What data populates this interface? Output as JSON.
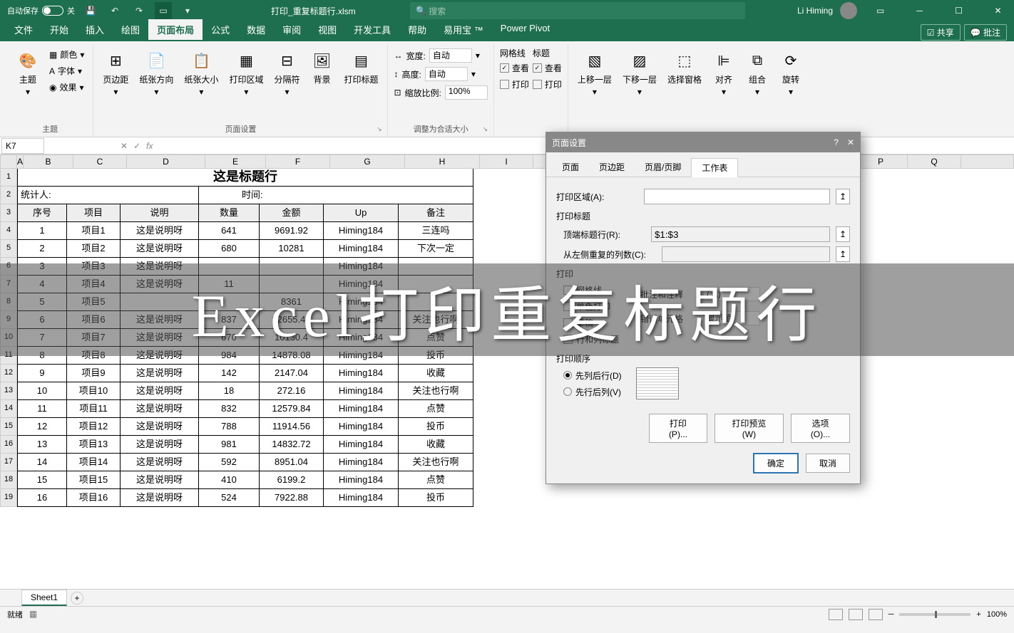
{
  "title": {
    "autosave": "自动保存",
    "autosave_state": "关",
    "filename": "打印_重复标题行.xlsm",
    "search_placeholder": "搜索",
    "username": "Li Himing"
  },
  "tabs": [
    "文件",
    "开始",
    "插入",
    "绘图",
    "页面布局",
    "公式",
    "数据",
    "审阅",
    "视图",
    "开发工具",
    "帮助",
    "易用宝 ™",
    "Power Pivot"
  ],
  "tab_active_index": 4,
  "share": "共享",
  "comment": "批注",
  "ribbon": {
    "themes": {
      "theme": "主题",
      "colors": "颜色",
      "fonts": "字体",
      "effects": "效果",
      "group": "主题"
    },
    "page_setup": {
      "margins": "页边距",
      "orientation": "纸张方向",
      "size": "纸张大小",
      "print_area": "打印区域",
      "breaks": "分隔符",
      "background": "背景",
      "print_titles": "打印标题",
      "group": "页面设置"
    },
    "scale": {
      "width": "宽度:",
      "height": "高度:",
      "scale": "缩放比例:",
      "auto": "自动",
      "pct": "100%",
      "group": "调整为合适大小"
    },
    "sheet_opts": {
      "gridlines": "网格线",
      "headings": "标题",
      "view": "查看",
      "print": "打印"
    },
    "arrange": {
      "bring_fwd": "上移一层",
      "send_back": "下移一层",
      "selection": "选择窗格",
      "align": "对齐",
      "group_btn": "组合",
      "rotate": "旋转"
    }
  },
  "namebox": "K7",
  "sheet": {
    "cols": [
      "A",
      "B",
      "C",
      "D",
      "E",
      "F",
      "G",
      "H"
    ],
    "title": "这是标题行",
    "stat_label": "统计人:",
    "time_label": "时间:",
    "headers": [
      "序号",
      "项目",
      "说明",
      "数量",
      "金额",
      "Up",
      "备注"
    ],
    "rows": [
      [
        "1",
        "项目1",
        "这是说明呀",
        "641",
        "9691.92",
        "Himing184",
        "三连吗"
      ],
      [
        "2",
        "项目2",
        "这是说明呀",
        "680",
        "10281",
        "Himing184",
        "下次一定"
      ],
      [
        "3",
        "项目3",
        "这是说明呀",
        "",
        "",
        "Himing184",
        ""
      ],
      [
        "4",
        "项目4",
        "这是说明呀",
        "11",
        "",
        "Himing184",
        ""
      ],
      [
        "5",
        "项目5",
        "",
        "",
        "8361",
        "Himing184",
        ""
      ],
      [
        "6",
        "项目6",
        "这是说明呀",
        "837",
        "12655.44",
        "Himing184",
        "关注也行啊"
      ],
      [
        "7",
        "项目7",
        "这是说明呀",
        "670",
        "10130.4",
        "Himing184",
        "点赞"
      ],
      [
        "8",
        "项目8",
        "这是说明呀",
        "984",
        "14878.08",
        "Himing184",
        "投币"
      ],
      [
        "9",
        "项目9",
        "这是说明呀",
        "142",
        "2147.04",
        "Himing184",
        "收藏"
      ],
      [
        "10",
        "项目10",
        "这是说明呀",
        "18",
        "272.16",
        "Himing184",
        "关注也行啊"
      ],
      [
        "11",
        "项目11",
        "这是说明呀",
        "832",
        "12579.84",
        "Himing184",
        "点赞"
      ],
      [
        "12",
        "项目12",
        "这是说明呀",
        "788",
        "11914.56",
        "Himing184",
        "投币"
      ],
      [
        "13",
        "项目13",
        "这是说明呀",
        "981",
        "14832.72",
        "Himing184",
        "收藏"
      ],
      [
        "14",
        "项目14",
        "这是说明呀",
        "592",
        "8951.04",
        "Himing184",
        "关注也行啊"
      ],
      [
        "15",
        "项目15",
        "这是说明呀",
        "410",
        "6199.2",
        "Himing184",
        "点赞"
      ],
      [
        "16",
        "项目16",
        "这是说明呀",
        "524",
        "7922.88",
        "Himing184",
        "投币"
      ]
    ],
    "tab_name": "Sheet1"
  },
  "dialog": {
    "title": "页面设置",
    "tabs": [
      "页面",
      "页边距",
      "页眉/页脚",
      "工作表"
    ],
    "active_tab": 3,
    "print_area": "打印区域(A):",
    "print_title": "打印标题",
    "rows_repeat": "顶端标题行(R):",
    "rows_value": "$1:$3",
    "cols_repeat": "从左侧重复的列数(C):",
    "print_section": "打印",
    "gridlines": "网格线",
    "bw": "单色打印",
    "draft": "草稿",
    "rowcol_hdr": "行和列标题",
    "comments": "批注和注释",
    "comments_val": "(无)",
    "errors": "错误单元格",
    "errors_val": "显示值",
    "order": "打印顺序",
    "down_over": "先列后行(D)",
    "over_down": "先行后列(V)",
    "print_btn": "打印(P)...",
    "preview_btn": "打印预览(W)",
    "options_btn": "选项(O)...",
    "ok": "确定",
    "cancel": "取消"
  },
  "status": {
    "ready": "就绪",
    "zoom": "100%"
  },
  "overlay": "Excel打印重复标题行"
}
